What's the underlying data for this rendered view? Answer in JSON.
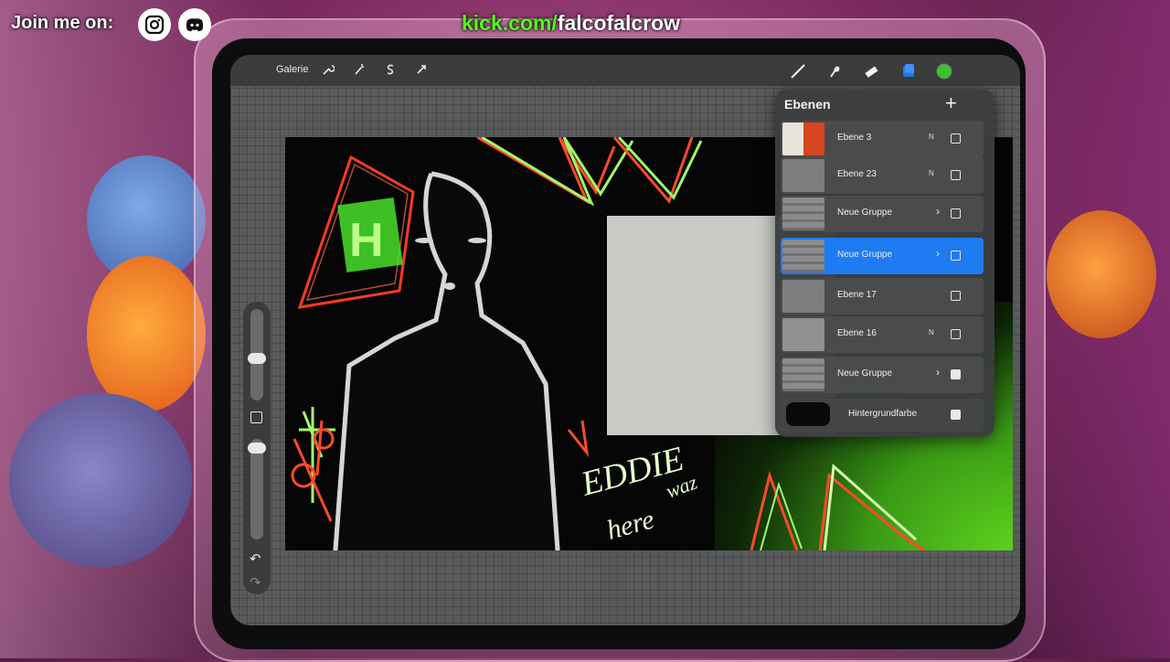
{
  "overlay": {
    "join_text": "Join me on:",
    "kick_domain": "kick.com/",
    "kick_user": "falcofalcrow",
    "icons": [
      "instagram-icon",
      "discord-icon"
    ]
  },
  "app": {
    "gallery_label": "Galerie",
    "tools_left": [
      "wrench-icon",
      "magic-wand-icon",
      "selection-icon",
      "transform-icon"
    ],
    "tools_right": [
      "brush-icon",
      "smudge-icon",
      "eraser-icon",
      "layers-icon",
      "color-icon"
    ],
    "active_color": "#39c52a",
    "accent_color": "#1e7bf2"
  },
  "layers_panel": {
    "title": "Ebenen",
    "add_icon": "plus-icon",
    "rows": [
      {
        "name": "Ebene 3",
        "blend": "N",
        "visible": false,
        "group": false,
        "selected": false
      },
      {
        "name": "Ebene 23",
        "blend": "N",
        "visible": false,
        "group": false,
        "selected": false
      },
      {
        "name": "Neue Gruppe",
        "blend": "",
        "visible": false,
        "group": true,
        "selected": false
      },
      {
        "name": "Neue Gruppe",
        "blend": "",
        "visible": false,
        "group": true,
        "selected": true
      },
      {
        "name": "Ebene 17",
        "blend": "",
        "visible": false,
        "group": false,
        "selected": false
      },
      {
        "name": "Ebene 16",
        "blend": "N",
        "visible": false,
        "group": false,
        "selected": false
      },
      {
        "name": "Neue Gruppe",
        "blend": "",
        "visible": true,
        "group": true,
        "selected": false
      }
    ],
    "background": {
      "name": "Hintergrundfarbe",
      "visible": true,
      "color": "#0a0a0a"
    }
  },
  "sidebar": {
    "undo_icon": "undo-icon",
    "redo_icon": "redo-icon"
  },
  "canvas": {
    "art_text_1": "EDDIE",
    "art_text_2": "here",
    "art_text_3": "waz",
    "art_letter": "H"
  }
}
